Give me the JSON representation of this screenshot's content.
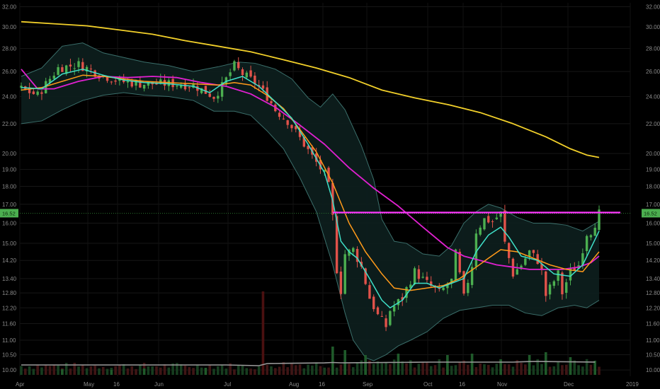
{
  "chart_data": {
    "type": "candlestick",
    "y_scale": "log",
    "ylim": [
      9.8,
      32.4
    ],
    "y_ticks": [
      "32.00",
      "30.00",
      "28.00",
      "26.00",
      "24.00",
      "22.00",
      "20.00",
      "19.00",
      "18.00",
      "17.00",
      "16.00",
      "15.00",
      "14.20",
      "13.40",
      "12.80",
      "12.20",
      "11.60",
      "11.00",
      "10.50",
      "10.00"
    ],
    "x_ticks": [
      "Apr",
      "May",
      "16",
      "Jun",
      "Jul",
      "Aug",
      "16",
      "Sep",
      "Oct",
      "16",
      "Nov",
      "Dec",
      "2019"
    ],
    "last_price_label": "16.52",
    "last_price": 16.52,
    "horizontal_line": {
      "value": 16.55,
      "color": "#ff33ff"
    },
    "grid": true,
    "colors": {
      "up": "#4caf50",
      "down": "#e0524a",
      "ema_fast": "#3fe0c8",
      "ema_mid": "#ff9a1a",
      "sma_slow": "#e020d0",
      "sma_long": "#f2d02a",
      "bollinger": "#3b6f6b",
      "volume_avg": "#9a9a9a"
    },
    "price_path": [
      [
        0,
        24.6
      ],
      [
        4,
        24.1
      ],
      [
        9,
        26.3
      ],
      [
        14,
        26.6
      ],
      [
        19,
        25.8
      ],
      [
        24,
        25.2
      ],
      [
        29,
        25.0
      ],
      [
        36,
        25.0
      ],
      [
        42,
        24.9
      ],
      [
        47,
        24.0
      ],
      [
        49,
        24.8
      ],
      [
        52,
        26.5
      ],
      [
        54,
        25.8
      ],
      [
        57,
        25.1
      ],
      [
        60,
        24.0
      ],
      [
        62,
        23.0
      ],
      [
        65,
        22.2
      ],
      [
        68,
        21.0
      ],
      [
        71,
        19.8
      ],
      [
        74,
        18.7
      ],
      [
        75,
        18.0
      ],
      [
        76,
        16.3
      ],
      [
        77,
        13.8
      ],
      [
        78,
        12.9
      ],
      [
        79,
        14.5
      ],
      [
        81,
        14.7
      ],
      [
        83,
        13.9
      ],
      [
        85,
        12.6
      ],
      [
        87,
        11.9
      ],
      [
        89,
        11.5
      ],
      [
        90,
        12.1
      ],
      [
        93,
        12.6
      ],
      [
        96,
        13.7
      ],
      [
        99,
        13.2
      ],
      [
        102,
        12.8
      ],
      [
        105,
        13.3
      ],
      [
        106,
        14.5
      ],
      [
        108,
        12.6
      ],
      [
        110,
        14.0
      ],
      [
        111,
        15.6
      ],
      [
        113,
        16.2
      ],
      [
        115,
        16.1
      ],
      [
        117,
        16.5
      ],
      [
        118,
        15.0
      ],
      [
        120,
        13.6
      ],
      [
        122,
        14.0
      ],
      [
        124,
        14.6
      ],
      [
        126,
        14.2
      ],
      [
        127,
        13.7
      ],
      [
        128,
        12.7
      ],
      [
        129,
        13.0
      ],
      [
        131,
        13.6
      ],
      [
        132,
        12.8
      ],
      [
        134,
        13.7
      ],
      [
        136,
        14.0
      ],
      [
        138,
        15.5
      ],
      [
        139,
        15.6
      ],
      [
        140,
        16.0
      ],
      [
        141,
        16.52
      ]
    ],
    "ema_fast": [
      [
        0,
        24.7
      ],
      [
        5,
        24.6
      ],
      [
        10,
        25.8
      ],
      [
        15,
        26.2
      ],
      [
        20,
        25.7
      ],
      [
        25,
        25.3
      ],
      [
        30,
        25.1
      ],
      [
        36,
        25.0
      ],
      [
        42,
        24.8
      ],
      [
        46,
        24.3
      ],
      [
        50,
        25.2
      ],
      [
        54,
        25.6
      ],
      [
        58,
        24.8
      ],
      [
        62,
        23.6
      ],
      [
        66,
        22.4
      ],
      [
        70,
        20.6
      ],
      [
        74,
        18.8
      ],
      [
        76,
        17.2
      ],
      [
        78,
        15.1
      ],
      [
        80,
        14.6
      ],
      [
        82,
        14.3
      ],
      [
        85,
        13.4
      ],
      [
        88,
        12.5
      ],
      [
        90,
        12.2
      ],
      [
        93,
        12.5
      ],
      [
        96,
        13.2
      ],
      [
        99,
        13.2
      ],
      [
        102,
        13.0
      ],
      [
        105,
        13.2
      ],
      [
        108,
        13.4
      ],
      [
        111,
        14.6
      ],
      [
        114,
        15.4
      ],
      [
        117,
        15.8
      ],
      [
        119,
        15.3
      ],
      [
        122,
        14.4
      ],
      [
        126,
        14.2
      ],
      [
        130,
        13.6
      ],
      [
        134,
        13.5
      ],
      [
        137,
        14.0
      ],
      [
        141,
        15.6
      ]
    ],
    "ema_mid": [
      [
        0,
        24.5
      ],
      [
        5,
        24.7
      ],
      [
        10,
        25.2
      ],
      [
        15,
        25.7
      ],
      [
        20,
        25.6
      ],
      [
        25,
        25.4
      ],
      [
        30,
        25.2
      ],
      [
        36,
        25.1
      ],
      [
        42,
        25.0
      ],
      [
        48,
        24.9
      ],
      [
        52,
        25.1
      ],
      [
        56,
        24.9
      ],
      [
        60,
        24.1
      ],
      [
        64,
        23.1
      ],
      [
        68,
        21.6
      ],
      [
        72,
        20.1
      ],
      [
        76,
        18.2
      ],
      [
        80,
        16.0
      ],
      [
        84,
        14.6
      ],
      [
        88,
        13.6
      ],
      [
        91,
        13.0
      ],
      [
        95,
        12.9
      ],
      [
        99,
        13.0
      ],
      [
        103,
        13.1
      ],
      [
        107,
        13.4
      ],
      [
        111,
        13.9
      ],
      [
        114,
        14.3
      ],
      [
        117,
        14.7
      ],
      [
        121,
        14.6
      ],
      [
        125,
        14.3
      ],
      [
        129,
        14.0
      ],
      [
        133,
        13.8
      ],
      [
        137,
        13.7
      ],
      [
        141,
        14.6
      ]
    ],
    "sma_slow": [
      [
        0,
        26.2
      ],
      [
        4,
        24.6
      ],
      [
        8,
        24.6
      ],
      [
        14,
        25.2
      ],
      [
        20,
        25.6
      ],
      [
        26,
        25.5
      ],
      [
        32,
        25.6
      ],
      [
        38,
        25.5
      ],
      [
        44,
        25.1
      ],
      [
        50,
        24.8
      ],
      [
        56,
        24.2
      ],
      [
        62,
        23.2
      ],
      [
        68,
        21.9
      ],
      [
        74,
        20.6
      ],
      [
        80,
        19.1
      ],
      [
        86,
        17.9
      ],
      [
        92,
        16.9
      ],
      [
        98,
        15.8
      ],
      [
        104,
        14.8
      ],
      [
        108,
        14.4
      ],
      [
        112,
        14.2
      ],
      [
        116,
        14.0
      ],
      [
        120,
        13.9
      ],
      [
        124,
        13.8
      ],
      [
        128,
        13.8
      ],
      [
        132,
        13.8
      ],
      [
        136,
        13.9
      ],
      [
        139,
        14.1
      ],
      [
        141,
        14.4
      ]
    ],
    "sma_long": [
      [
        0,
        30.5
      ],
      [
        8,
        30.3
      ],
      [
        16,
        30.1
      ],
      [
        24,
        29.7
      ],
      [
        32,
        29.3
      ],
      [
        40,
        28.7
      ],
      [
        48,
        28.2
      ],
      [
        56,
        27.7
      ],
      [
        64,
        27.0
      ],
      [
        72,
        26.3
      ],
      [
        80,
        25.5
      ],
      [
        88,
        24.5
      ],
      [
        96,
        23.9
      ],
      [
        104,
        23.4
      ],
      [
        112,
        22.8
      ],
      [
        120,
        22.0
      ],
      [
        128,
        21.1
      ],
      [
        134,
        20.3
      ],
      [
        138,
        19.9
      ],
      [
        141,
        19.75
      ]
    ],
    "bb_upper": [
      [
        0,
        25.6
      ],
      [
        5,
        26.3
      ],
      [
        10,
        28.2
      ],
      [
        15,
        28.5
      ],
      [
        20,
        27.6
      ],
      [
        25,
        27.2
      ],
      [
        30,
        26.8
      ],
      [
        36,
        26.5
      ],
      [
        42,
        26.0
      ],
      [
        48,
        26.4
      ],
      [
        53,
        26.8
      ],
      [
        57,
        26.7
      ],
      [
        62,
        26.2
      ],
      [
        66,
        25.4
      ],
      [
        70,
        23.9
      ],
      [
        73,
        23.2
      ],
      [
        76,
        24.2
      ],
      [
        79,
        23.0
      ],
      [
        83,
        20.5
      ],
      [
        86,
        18.4
      ],
      [
        88,
        16.2
      ],
      [
        91,
        15.1
      ],
      [
        94,
        15.0
      ],
      [
        98,
        14.5
      ],
      [
        102,
        14.4
      ],
      [
        105,
        14.9
      ],
      [
        108,
        16.0
      ],
      [
        111,
        16.6
      ],
      [
        114,
        17.0
      ],
      [
        117,
        16.8
      ],
      [
        121,
        16.3
      ],
      [
        125,
        16.0
      ],
      [
        129,
        16.0
      ],
      [
        133,
        15.9
      ],
      [
        137,
        15.6
      ],
      [
        141,
        16.1
      ]
    ],
    "bb_lower": [
      [
        0,
        22.0
      ],
      [
        5,
        22.2
      ],
      [
        10,
        23.0
      ],
      [
        15,
        23.7
      ],
      [
        20,
        24.1
      ],
      [
        25,
        24.3
      ],
      [
        30,
        24.1
      ],
      [
        36,
        24.0
      ],
      [
        42,
        23.7
      ],
      [
        47,
        22.9
      ],
      [
        52,
        22.9
      ],
      [
        56,
        22.6
      ],
      [
        60,
        21.5
      ],
      [
        64,
        20.3
      ],
      [
        68,
        18.5
      ],
      [
        72,
        16.6
      ],
      [
        76,
        14.0
      ],
      [
        79,
        12.0
      ],
      [
        81,
        11.0
      ],
      [
        84,
        10.4
      ],
      [
        86,
        10.3
      ],
      [
        89,
        10.5
      ],
      [
        92,
        10.8
      ],
      [
        95,
        11.0
      ],
      [
        99,
        11.3
      ],
      [
        103,
        11.8
      ],
      [
        107,
        12.1
      ],
      [
        111,
        12.2
      ],
      [
        115,
        12.3
      ],
      [
        119,
        12.3
      ],
      [
        123,
        12.0
      ],
      [
        127,
        11.9
      ],
      [
        131,
        12.2
      ],
      [
        135,
        12.3
      ],
      [
        138,
        12.2
      ],
      [
        141,
        12.5
      ]
    ],
    "volume_baseline": [
      [
        0,
        14
      ],
      [
        50,
        14
      ],
      [
        58,
        13
      ],
      [
        60,
        16
      ],
      [
        75,
        17
      ],
      [
        77,
        18
      ],
      [
        78,
        17
      ],
      [
        100,
        18
      ],
      [
        120,
        18
      ],
      [
        125,
        19
      ],
      [
        141,
        18
      ]
    ],
    "volume_spikes": [
      [
        10,
        8
      ],
      [
        22,
        7
      ],
      [
        30,
        9
      ],
      [
        45,
        10
      ],
      [
        59,
        118
      ],
      [
        76,
        40
      ],
      [
        79,
        35
      ],
      [
        84,
        28
      ],
      [
        92,
        30
      ],
      [
        104,
        28
      ],
      [
        110,
        30
      ],
      [
        117,
        22
      ],
      [
        124,
        28
      ],
      [
        128,
        32
      ],
      [
        134,
        25
      ],
      [
        140,
        20
      ]
    ]
  }
}
